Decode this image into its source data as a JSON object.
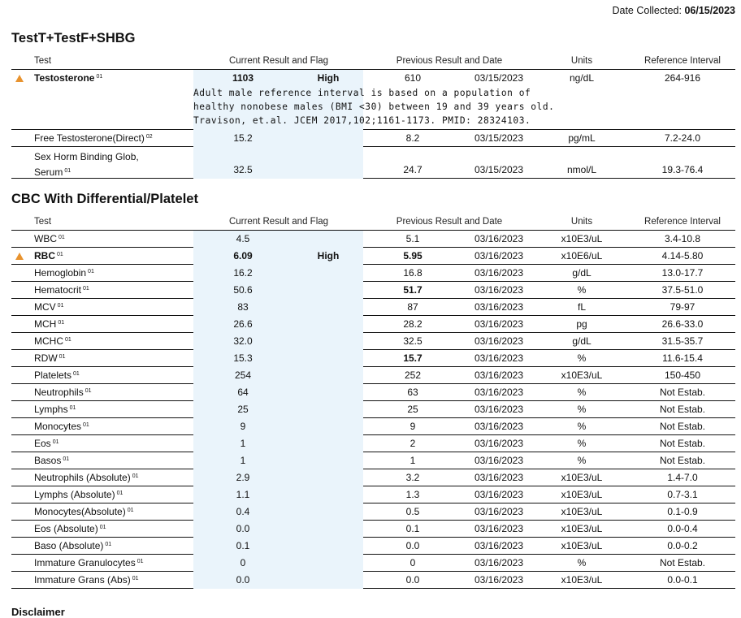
{
  "date_collected_label": "Date Collected:",
  "date_collected": "06/15/2023",
  "headers": {
    "test": "Test",
    "current": "Current Result and Flag",
    "previous": "Previous Result and Date",
    "units": "Units",
    "reference": "Reference Interval"
  },
  "colors": {
    "flag": "#e8932f",
    "current_bg": "#eaf4fb"
  },
  "sections": [
    {
      "title": "TestT+TestF+SHBG",
      "rows": [
        {
          "name": "Testosterone",
          "sup": "01",
          "flagged": true,
          "bold_name": true,
          "result": "1103",
          "result_bold": true,
          "flag": "High",
          "prev": "610",
          "prev_bold": false,
          "prev_date": "03/15/2023",
          "units": "ng/dL",
          "ref": "264-916",
          "note": "Adult male reference interval is based on a population of\nhealthy nonobese males (BMI <30) between 19 and 39 years old.\nTravison, et.al. JCEM 2017,102;1161-1173. PMID: 28324103."
        },
        {
          "name": "Free Testosterone(Direct)",
          "sup": "02",
          "flagged": false,
          "bold_name": false,
          "result": "15.2",
          "result_bold": false,
          "flag": "",
          "prev": "8.2",
          "prev_bold": false,
          "prev_date": "03/15/2023",
          "units": "pg/mL",
          "ref": "7.2-24.0"
        },
        {
          "name": "Sex Horm Binding Glob,",
          "name2": "Serum",
          "sup": "01",
          "flagged": false,
          "bold_name": false,
          "result": "32.5",
          "result_bold": false,
          "flag": "",
          "prev": "24.7",
          "prev_bold": false,
          "prev_date": "03/15/2023",
          "units": "nmol/L",
          "ref": "19.3-76.4"
        }
      ]
    },
    {
      "title": "CBC With Differential/Platelet",
      "rows": [
        {
          "name": "WBC",
          "sup": "01",
          "flagged": false,
          "bold_name": false,
          "result": "4.5",
          "result_bold": false,
          "flag": "",
          "prev": "5.1",
          "prev_bold": false,
          "prev_date": "03/16/2023",
          "units": "x10E3/uL",
          "ref": "3.4-10.8"
        },
        {
          "name": "RBC",
          "sup": "01",
          "flagged": true,
          "bold_name": true,
          "result": "6.09",
          "result_bold": true,
          "flag": "High",
          "prev": "5.95",
          "prev_bold": true,
          "prev_date": "03/16/2023",
          "units": "x10E6/uL",
          "ref": "4.14-5.80"
        },
        {
          "name": "Hemoglobin",
          "sup": "01",
          "flagged": false,
          "bold_name": false,
          "result": "16.2",
          "result_bold": false,
          "flag": "",
          "prev": "16.8",
          "prev_bold": false,
          "prev_date": "03/16/2023",
          "units": "g/dL",
          "ref": "13.0-17.7"
        },
        {
          "name": "Hematocrit",
          "sup": "01",
          "flagged": false,
          "bold_name": false,
          "result": "50.6",
          "result_bold": false,
          "flag": "",
          "prev": "51.7",
          "prev_bold": true,
          "prev_date": "03/16/2023",
          "units": "%",
          "ref": "37.5-51.0"
        },
        {
          "name": "MCV",
          "sup": "01",
          "flagged": false,
          "bold_name": false,
          "result": "83",
          "result_bold": false,
          "flag": "",
          "prev": "87",
          "prev_bold": false,
          "prev_date": "03/16/2023",
          "units": "fL",
          "ref": "79-97"
        },
        {
          "name": "MCH",
          "sup": "01",
          "flagged": false,
          "bold_name": false,
          "result": "26.6",
          "result_bold": false,
          "flag": "",
          "prev": "28.2",
          "prev_bold": false,
          "prev_date": "03/16/2023",
          "units": "pg",
          "ref": "26.6-33.0"
        },
        {
          "name": "MCHC",
          "sup": "01",
          "flagged": false,
          "bold_name": false,
          "result": "32.0",
          "result_bold": false,
          "flag": "",
          "prev": "32.5",
          "prev_bold": false,
          "prev_date": "03/16/2023",
          "units": "g/dL",
          "ref": "31.5-35.7"
        },
        {
          "name": "RDW",
          "sup": "01",
          "flagged": false,
          "bold_name": false,
          "result": "15.3",
          "result_bold": false,
          "flag": "",
          "prev": "15.7",
          "prev_bold": true,
          "prev_date": "03/16/2023",
          "units": "%",
          "ref": "11.6-15.4"
        },
        {
          "name": "Platelets",
          "sup": "01",
          "flagged": false,
          "bold_name": false,
          "result": "254",
          "result_bold": false,
          "flag": "",
          "prev": "252",
          "prev_bold": false,
          "prev_date": "03/16/2023",
          "units": "x10E3/uL",
          "ref": "150-450"
        },
        {
          "name": "Neutrophils",
          "sup": "01",
          "flagged": false,
          "bold_name": false,
          "result": "64",
          "result_bold": false,
          "flag": "",
          "prev": "63",
          "prev_bold": false,
          "prev_date": "03/16/2023",
          "units": "%",
          "ref": "Not Estab."
        },
        {
          "name": "Lymphs",
          "sup": "01",
          "flagged": false,
          "bold_name": false,
          "result": "25",
          "result_bold": false,
          "flag": "",
          "prev": "25",
          "prev_bold": false,
          "prev_date": "03/16/2023",
          "units": "%",
          "ref": "Not Estab."
        },
        {
          "name": "Monocytes",
          "sup": "01",
          "flagged": false,
          "bold_name": false,
          "result": "9",
          "result_bold": false,
          "flag": "",
          "prev": "9",
          "prev_bold": false,
          "prev_date": "03/16/2023",
          "units": "%",
          "ref": "Not Estab."
        },
        {
          "name": "Eos",
          "sup": "01",
          "flagged": false,
          "bold_name": false,
          "result": "1",
          "result_bold": false,
          "flag": "",
          "prev": "2",
          "prev_bold": false,
          "prev_date": "03/16/2023",
          "units": "%",
          "ref": "Not Estab."
        },
        {
          "name": "Basos",
          "sup": "01",
          "flagged": false,
          "bold_name": false,
          "result": "1",
          "result_bold": false,
          "flag": "",
          "prev": "1",
          "prev_bold": false,
          "prev_date": "03/16/2023",
          "units": "%",
          "ref": "Not Estab."
        },
        {
          "name": "Neutrophils (Absolute)",
          "sup": "01",
          "flagged": false,
          "bold_name": false,
          "result": "2.9",
          "result_bold": false,
          "flag": "",
          "prev": "3.2",
          "prev_bold": false,
          "prev_date": "03/16/2023",
          "units": "x10E3/uL",
          "ref": "1.4-7.0"
        },
        {
          "name": "Lymphs (Absolute)",
          "sup": "01",
          "flagged": false,
          "bold_name": false,
          "result": "1.1",
          "result_bold": false,
          "flag": "",
          "prev": "1.3",
          "prev_bold": false,
          "prev_date": "03/16/2023",
          "units": "x10E3/uL",
          "ref": "0.7-3.1"
        },
        {
          "name": "Monocytes(Absolute)",
          "sup": "01",
          "flagged": false,
          "bold_name": false,
          "result": "0.4",
          "result_bold": false,
          "flag": "",
          "prev": "0.5",
          "prev_bold": false,
          "prev_date": "03/16/2023",
          "units": "x10E3/uL",
          "ref": "0.1-0.9"
        },
        {
          "name": "Eos (Absolute)",
          "sup": "01",
          "flagged": false,
          "bold_name": false,
          "result": "0.0",
          "result_bold": false,
          "flag": "",
          "prev": "0.1",
          "prev_bold": false,
          "prev_date": "03/16/2023",
          "units": "x10E3/uL",
          "ref": "0.0-0.4"
        },
        {
          "name": "Baso (Absolute)",
          "sup": "01",
          "flagged": false,
          "bold_name": false,
          "result": "0.1",
          "result_bold": false,
          "flag": "",
          "prev": "0.0",
          "prev_bold": false,
          "prev_date": "03/16/2023",
          "units": "x10E3/uL",
          "ref": "0.0-0.2"
        },
        {
          "name": "Immature Granulocytes",
          "sup": "01",
          "flagged": false,
          "bold_name": false,
          "result": "0",
          "result_bold": false,
          "flag": "",
          "prev": "0",
          "prev_bold": false,
          "prev_date": "03/16/2023",
          "units": "%",
          "ref": "Not Estab."
        },
        {
          "name": "Immature Grans (Abs)",
          "sup": "01",
          "flagged": false,
          "bold_name": false,
          "result": "0.0",
          "result_bold": false,
          "flag": "",
          "prev": "0.0",
          "prev_bold": false,
          "prev_date": "03/16/2023",
          "units": "x10E3/uL",
          "ref": "0.0-0.1"
        }
      ]
    }
  ],
  "footer_heading": "Disclaimer"
}
